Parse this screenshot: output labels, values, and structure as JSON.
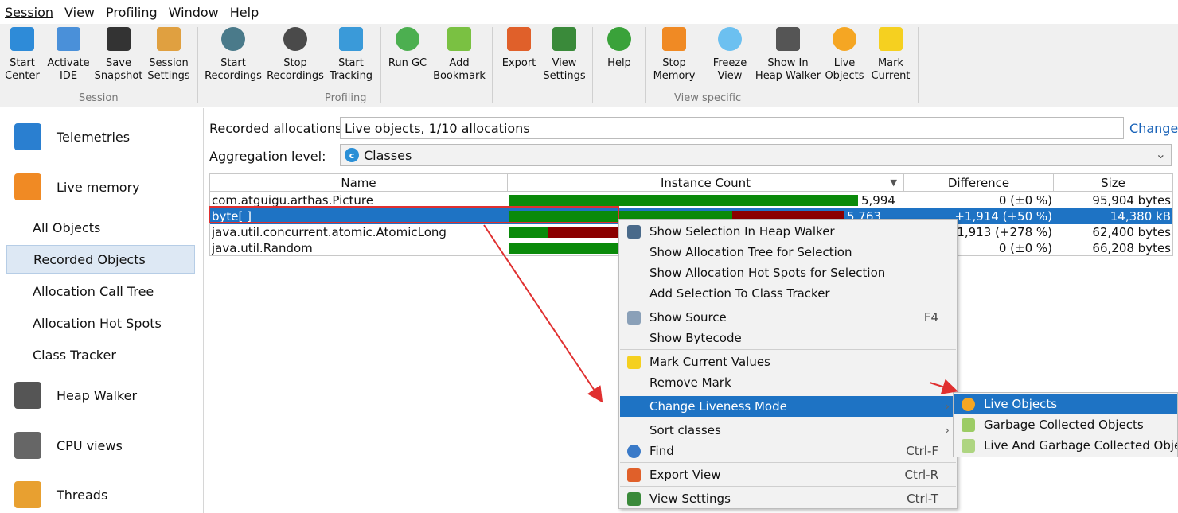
{
  "menubar": [
    "Session",
    "View",
    "Profiling",
    "Window",
    "Help"
  ],
  "toolbar": {
    "groups": [
      "Session",
      "Profiling",
      "View specific"
    ],
    "buttons": [
      {
        "label": "Start\nCenter",
        "icon": "start-center-icon",
        "color": "#2e8bd8"
      },
      {
        "label": "Activate\nIDE",
        "icon": "ide-icon",
        "color": "#4a90d9"
      },
      {
        "label": "Save\nSnapshot",
        "icon": "save-icon",
        "color": "#333333"
      },
      {
        "label": "Session\nSettings",
        "icon": "settings-icon",
        "color": "#e0a040"
      },
      {
        "label": "Start\nRecordings",
        "icon": "record-icon",
        "color": "#4a7a8a"
      },
      {
        "label": "Stop\nRecordings",
        "icon": "stop-record-icon",
        "color": "#4a4a4a"
      },
      {
        "label": "Start\nTracking",
        "icon": "tracking-icon",
        "color": "#3a9ad9"
      },
      {
        "label": "Run GC",
        "icon": "gc-icon",
        "color": "#4caf50"
      },
      {
        "label": "Add\nBookmark",
        "icon": "bookmark-icon",
        "color": "#7ac142"
      },
      {
        "label": "Export",
        "icon": "export-icon",
        "color": "#e0602a"
      },
      {
        "label": "View\nSettings",
        "icon": "view-settings-icon",
        "color": "#3a8a3a"
      },
      {
        "label": "Help",
        "icon": "help-icon",
        "color": "#3aa23a"
      },
      {
        "label": "Stop\nMemory",
        "icon": "stop-memory-icon",
        "color": "#f08a24"
      },
      {
        "label": "Freeze\nView",
        "icon": "snowflake-icon",
        "color": "#6cc0f0"
      },
      {
        "label": "Show In\nHeap Walker",
        "icon": "camera-icon",
        "color": "#555555"
      },
      {
        "label": "Live\nObjects",
        "icon": "live-objects-icon",
        "color": "#f5a623"
      },
      {
        "label": "Mark\nCurrent",
        "icon": "mark-icon",
        "color": "#f5d020"
      }
    ]
  },
  "sidebar": {
    "sections": [
      {
        "label": "Telemetries",
        "icon": "telemetries-icon",
        "color": "#2a7fd0"
      },
      {
        "label": "Live memory",
        "icon": "live-memory-icon",
        "color": "#f08a24"
      },
      {
        "label": "Heap Walker",
        "icon": "heap-walker-icon",
        "color": "#555555"
      },
      {
        "label": "CPU views",
        "icon": "cpu-icon",
        "color": "#666666"
      },
      {
        "label": "Threads",
        "icon": "threads-icon",
        "color": "#e8a030"
      }
    ],
    "sub_items": [
      "All Objects",
      "Recorded Objects",
      "Allocation Call Tree",
      "Allocation Hot Spots",
      "Class Tracker"
    ],
    "selected": "Recorded Objects"
  },
  "main": {
    "recorded_label": "Recorded allocations:",
    "recorded_value": "Live objects, 1/10 allocations",
    "change_link": "Change",
    "aggregation_label": "Aggregation level:",
    "aggregation_value": "Classes",
    "aggregation_icon_letter": "c"
  },
  "table": {
    "columns": [
      "Name",
      "Instance Count",
      "Difference",
      "Size"
    ],
    "sort_indicator": "▼",
    "rows": [
      {
        "name": "com.atguigu.arthas.Picture",
        "count": "5,994",
        "diff": "0 (±0 %)",
        "size": "95,904 bytes",
        "green": 1.0,
        "red": 0.0
      },
      {
        "name": "byte[ ]",
        "count": "5,763",
        "diff": "+1,914 (+50 %)",
        "size": "14,380 kB",
        "green": 0.64,
        "red": 0.32,
        "selected": true
      },
      {
        "name": "java.util.concurrent.atomic.AtomicLong",
        "count": "",
        "diff": "+1,913 (+278 %)",
        "size": "62,400 bytes",
        "green": 0.11,
        "red": 0.22
      },
      {
        "name": "java.util.Random",
        "count": "",
        "diff": "0 (±0 %)",
        "size": "66,208 bytes",
        "green": 1.0,
        "red": 0.0
      }
    ],
    "colors": {
      "green": "#0a8a0a",
      "red": "#8b0000",
      "selection": "#1e73c4"
    }
  },
  "context_menu": {
    "items": [
      {
        "label": "Show Selection In Heap Walker",
        "icon": "camera-icon",
        "shortcut": ""
      },
      {
        "label": "Show Allocation Tree for Selection",
        "shortcut": ""
      },
      {
        "label": "Show Allocation Hot Spots for Selection",
        "shortcut": ""
      },
      {
        "label": "Add Selection To Class Tracker",
        "shortcut": ""
      },
      {
        "label": "Show Source",
        "icon": "source-icon",
        "shortcut": "F4"
      },
      {
        "label": "Show Bytecode",
        "shortcut": ""
      },
      {
        "label": "Mark Current Values",
        "icon": "mark-icon",
        "shortcut": ""
      },
      {
        "label": "Remove Mark",
        "shortcut": ""
      },
      {
        "label": "Change Liveness Mode",
        "shortcut": "",
        "submenu": true,
        "highlighted": true
      },
      {
        "label": "Sort classes",
        "shortcut": "",
        "submenu": true
      },
      {
        "label": "Find",
        "icon": "find-icon",
        "shortcut": "Ctrl-F"
      },
      {
        "label": "Export View",
        "icon": "export-icon",
        "shortcut": "Ctrl-R"
      },
      {
        "label": "View Settings",
        "icon": "view-settings-icon",
        "shortcut": "Ctrl-T"
      }
    ]
  },
  "submenu": {
    "items": [
      {
        "label": "Live Objects",
        "highlighted": true,
        "color": "#f5a623"
      },
      {
        "label": "Garbage Collected Objects",
        "color": "#9ccc65"
      },
      {
        "label": "Live And Garbage Collected Objects",
        "color": "#aed581"
      }
    ]
  },
  "annotation_color": "#e03030"
}
